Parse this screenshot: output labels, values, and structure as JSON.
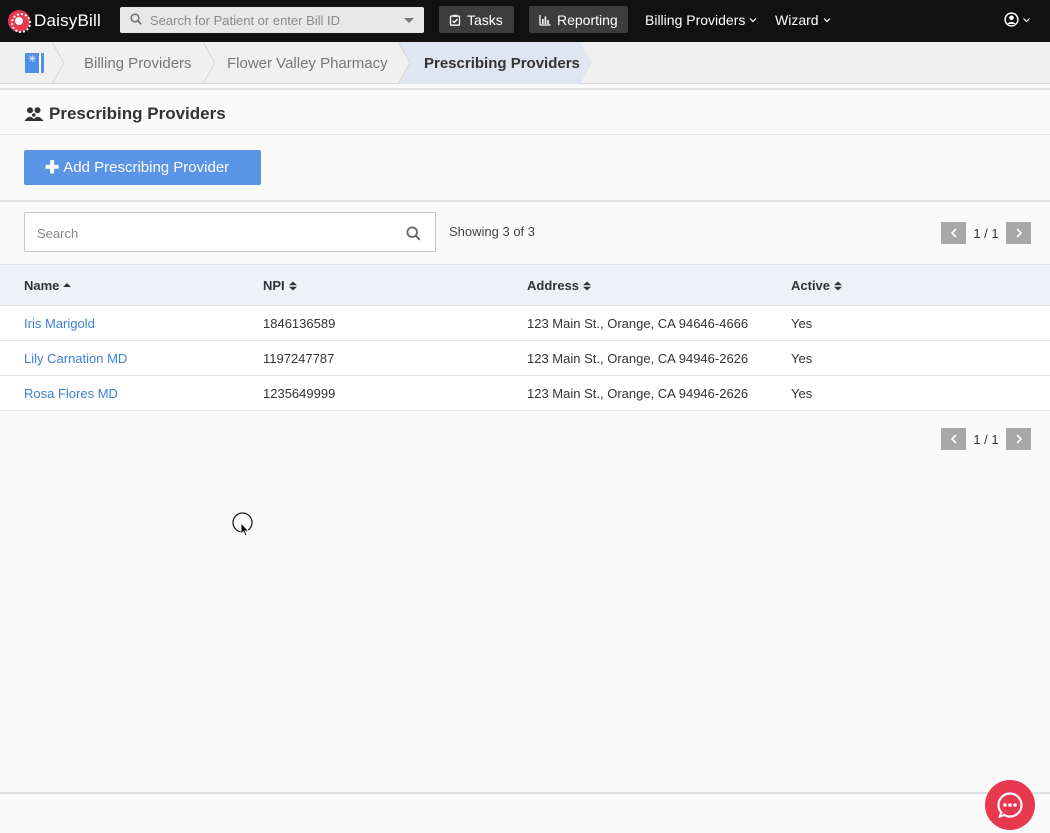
{
  "topnav": {
    "brand": "DaisyBill",
    "search_placeholder": "Search for Patient or enter Bill ID",
    "tasks_label": "Tasks",
    "reporting_label": "Reporting",
    "billing_providers_label": "Billing Providers",
    "wizard_label": "Wizard"
  },
  "breadcrumb": {
    "items": [
      "Billing Providers",
      "Flower Valley Pharmacy",
      "Prescribing Providers"
    ]
  },
  "page": {
    "title": "Prescribing Providers",
    "add_button_label": "Add Prescribing Provider"
  },
  "table_tools": {
    "search_placeholder": "Search",
    "showing_text": "Showing 3 of 3",
    "page_indicator": "1 / 1"
  },
  "table": {
    "columns": [
      "Name",
      "NPI",
      "Address",
      "Active"
    ],
    "rows": [
      {
        "name": "Iris Marigold",
        "npi": "1846136589",
        "address": "123 Main St., Orange, CA 94646-4666",
        "active": "Yes"
      },
      {
        "name": "Lily Carnation MD",
        "npi": "1197247787",
        "address": "123 Main St., Orange, CA 94946-2626",
        "active": "Yes"
      },
      {
        "name": "Rosa Flores MD",
        "npi": "1235649999",
        "address": "123 Main St., Orange, CA 94946-2626",
        "active": "Yes"
      }
    ]
  },
  "colors": {
    "accent": "#5b95e8",
    "link": "#3d7fd6",
    "brand": "#e8384f",
    "nav_bg": "#111111"
  },
  "icons": [
    "daisy-logo-icon",
    "search-icon",
    "dropdown-caret-icon",
    "tasks-icon",
    "reporting-chart-icon",
    "chevron-down-icon",
    "user-circle-icon",
    "home-icon",
    "users-icon",
    "plus-icon",
    "sort-asc-icon",
    "sort-icon",
    "chevron-left-icon",
    "chevron-right-icon",
    "chat-icon"
  ]
}
